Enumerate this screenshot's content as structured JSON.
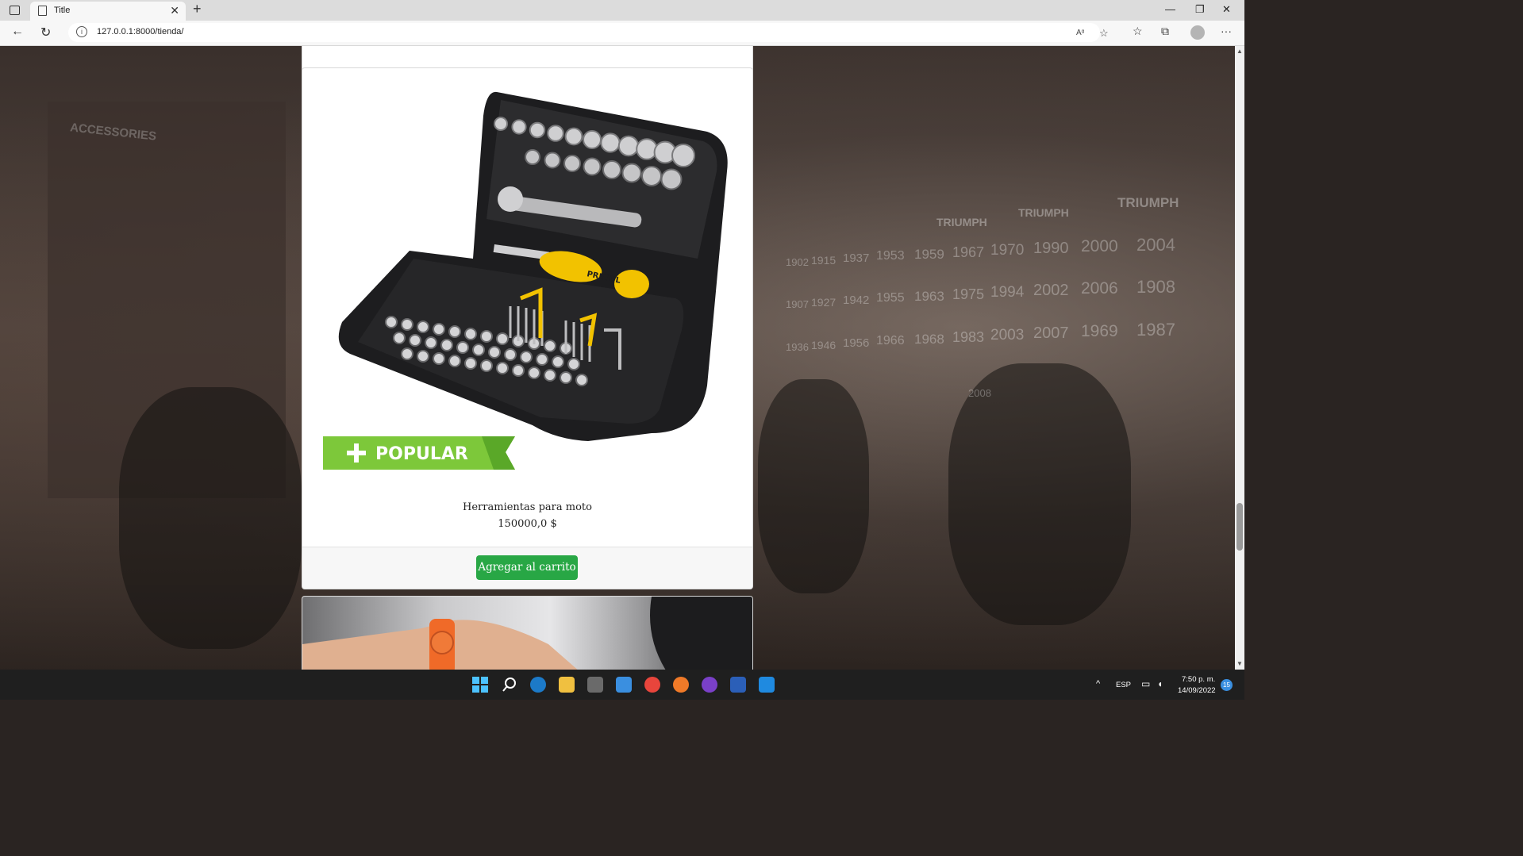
{
  "browser": {
    "tab_title": "Title",
    "tab_close": "✕",
    "new_tab": "+",
    "url": "127.0.0.1:8000/tienda/",
    "url_info_icon": "i",
    "read_aloud": "Aᵅ",
    "minimize": "—",
    "restore": "❐",
    "close": "✕",
    "more": "···"
  },
  "background": {
    "sign_accessories": "ACCESSORIES",
    "brand_1": "TRIUMPH",
    "brand_2": "TRIUMPH",
    "brand_3": "TRIUMPH",
    "years": [
      "1902",
      "1915",
      "1937",
      "1953",
      "1959",
      "1967",
      "1970",
      "1990",
      "2000",
      "2004",
      "1907",
      "1927",
      "1942",
      "1955",
      "1963",
      "1975",
      "1994",
      "2002",
      "2006",
      "1908",
      "1936",
      "1946",
      "1956",
      "1966",
      "1968",
      "1983",
      "2003",
      "2007",
      "1969",
      "1987",
      "2008"
    ]
  },
  "products": [
    {
      "badge": "POPULAR",
      "kit_brand": "PRETUL",
      "name": "Herramientas para moto",
      "price": "150000,0 $",
      "button": "Agregar al carrito"
    }
  ],
  "taskbar": {
    "language": "ESP",
    "time": "7:50 p. m.",
    "date": "14/09/2022",
    "notifications": "15"
  }
}
